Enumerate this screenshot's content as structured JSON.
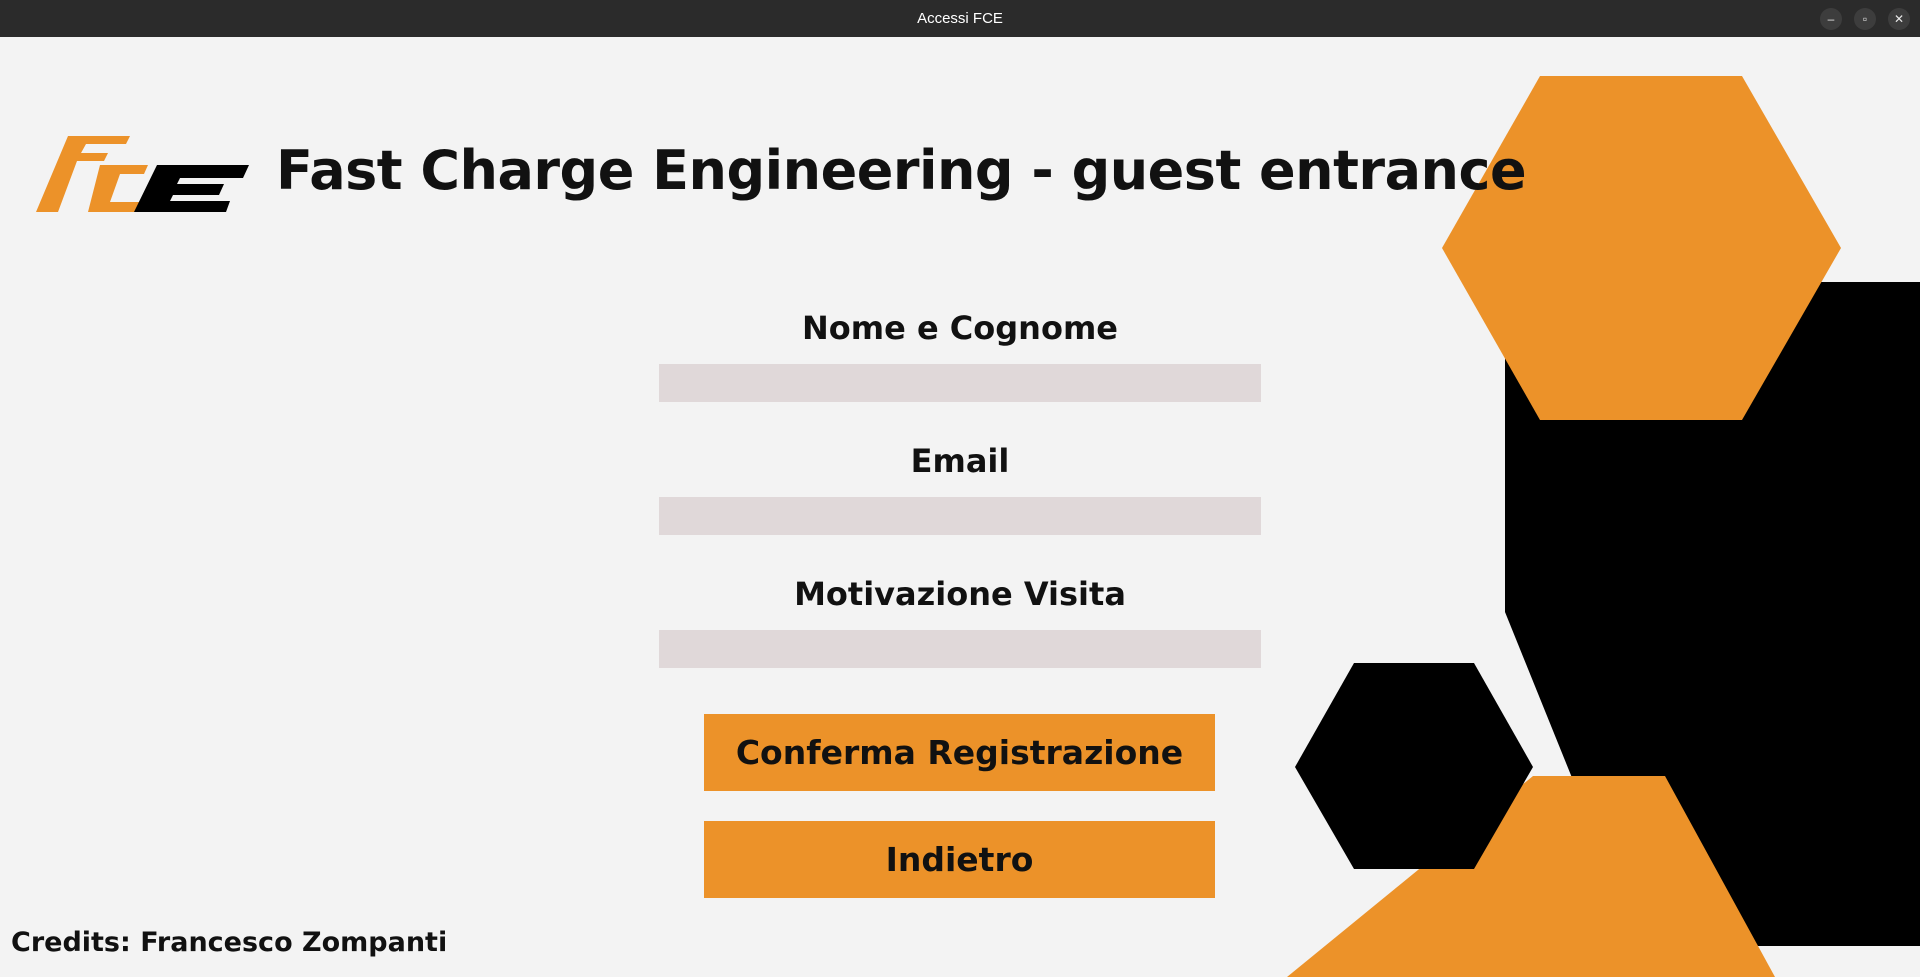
{
  "window": {
    "title": "Accessi FCE",
    "controls": {
      "minimize": "–",
      "maximize": "▫",
      "close": "✕"
    }
  },
  "header": {
    "logo_icon": "fce-logo",
    "title": "Fast Charge Engineering - guest entrance"
  },
  "form": {
    "fields": [
      {
        "label": "Nome e Cognome",
        "value": ""
      },
      {
        "label": "Email",
        "value": ""
      },
      {
        "label": "Motivazione Visita",
        "value": ""
      }
    ],
    "confirm_label": "Conferma Registrazione",
    "back_label": "Indietro"
  },
  "footer": {
    "credits": "Credits: Francesco Zompanti"
  },
  "colors": {
    "accent": "#ec9229",
    "dark": "#000000",
    "background": "#f3f3f3",
    "input_bg": "#e0d8d9"
  }
}
